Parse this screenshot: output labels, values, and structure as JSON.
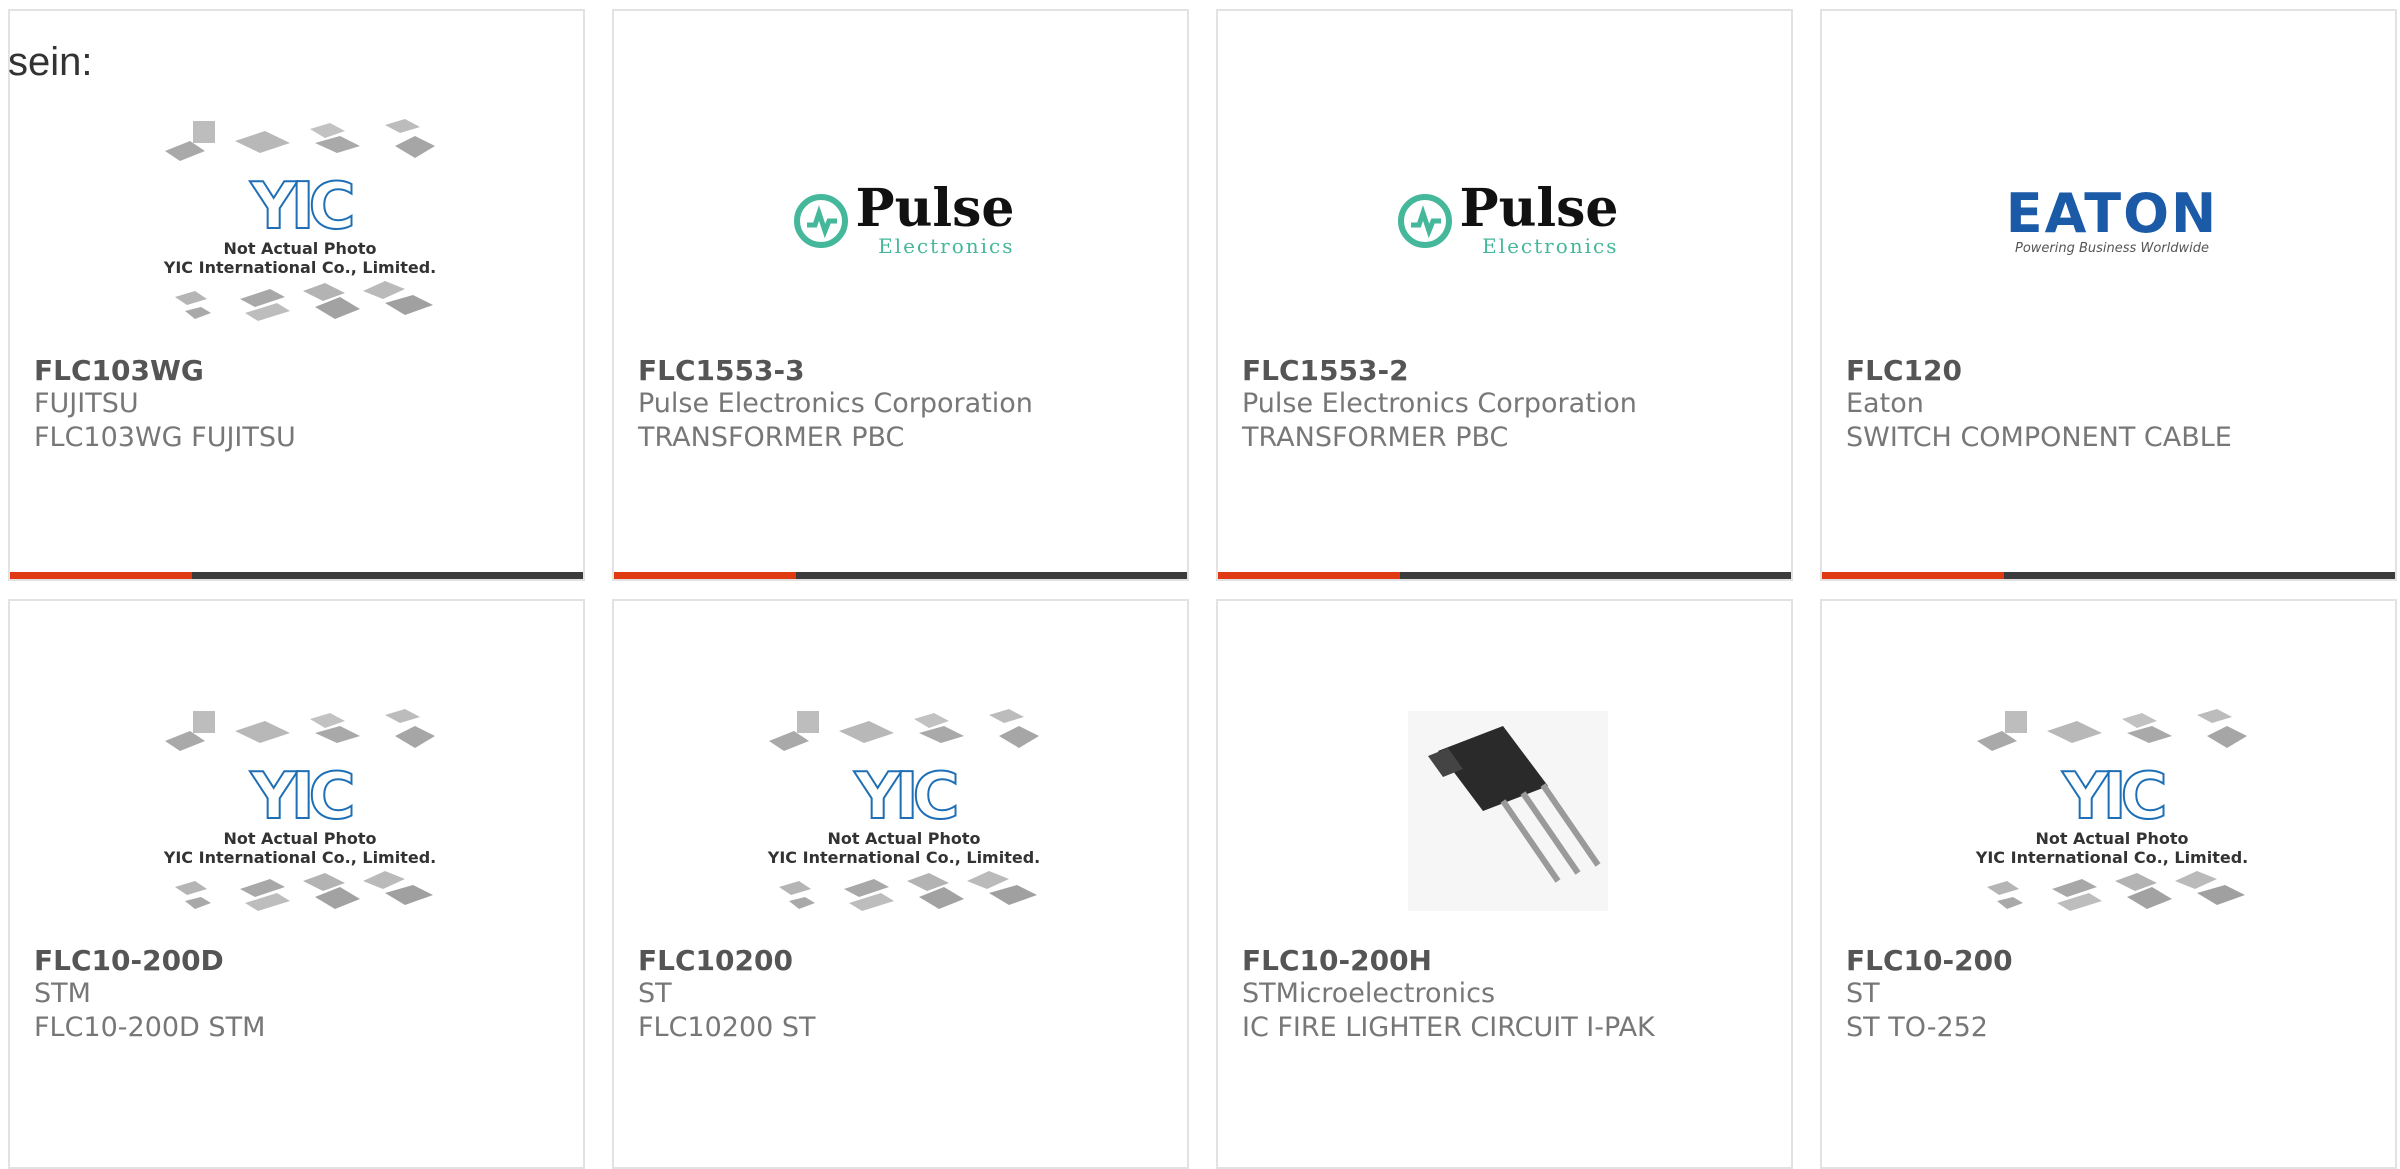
{
  "lead_text": "sein:",
  "colors": {
    "accent": "#e03a12",
    "bar": "#3b3b3b",
    "border": "#e2e2e2",
    "yic_blue": "#1e6fb5",
    "pulse_green": "#45b79a",
    "eaton_blue": "#1b5aa6"
  },
  "placeholder": {
    "line1": "Not Actual Photo",
    "line2": "YIC International Co., Limited.",
    "logo": "YIC"
  },
  "logos": {
    "pulse_word": "Pulse",
    "pulse_sub": "Electronics",
    "eaton_word": "EATON",
    "eaton_tag": "Powering Business Worldwide"
  },
  "products": [
    {
      "part": "FLC103WG",
      "maker": "FUJITSU",
      "desc": "FLC103WG FUJITSU",
      "image": "yic-placeholder"
    },
    {
      "part": "FLC1553-3",
      "maker": "Pulse Electronics Corporation",
      "desc": "TRANSFORMER PBC",
      "image": "pulse-logo"
    },
    {
      "part": "FLC1553-2",
      "maker": "Pulse Electronics Corporation",
      "desc": "TRANSFORMER PBC",
      "image": "pulse-logo"
    },
    {
      "part": "FLC120",
      "maker": "Eaton",
      "desc": "SWITCH COMPONENT CABLE",
      "image": "eaton-logo"
    },
    {
      "part": "FLC10-200D",
      "maker": "STM",
      "desc": "FLC10-200D STM",
      "image": "yic-placeholder"
    },
    {
      "part": "FLC10200",
      "maker": "ST",
      "desc": "FLC10200 ST",
      "image": "yic-placeholder"
    },
    {
      "part": "FLC10-200H",
      "maker": "STMicroelectronics",
      "desc": "IC FIRE LIGHTER CIRCUIT I-PAK",
      "image": "ipak-transistor"
    },
    {
      "part": "FLC10-200",
      "maker": "ST",
      "desc": "ST TO-252",
      "image": "yic-placeholder"
    }
  ]
}
